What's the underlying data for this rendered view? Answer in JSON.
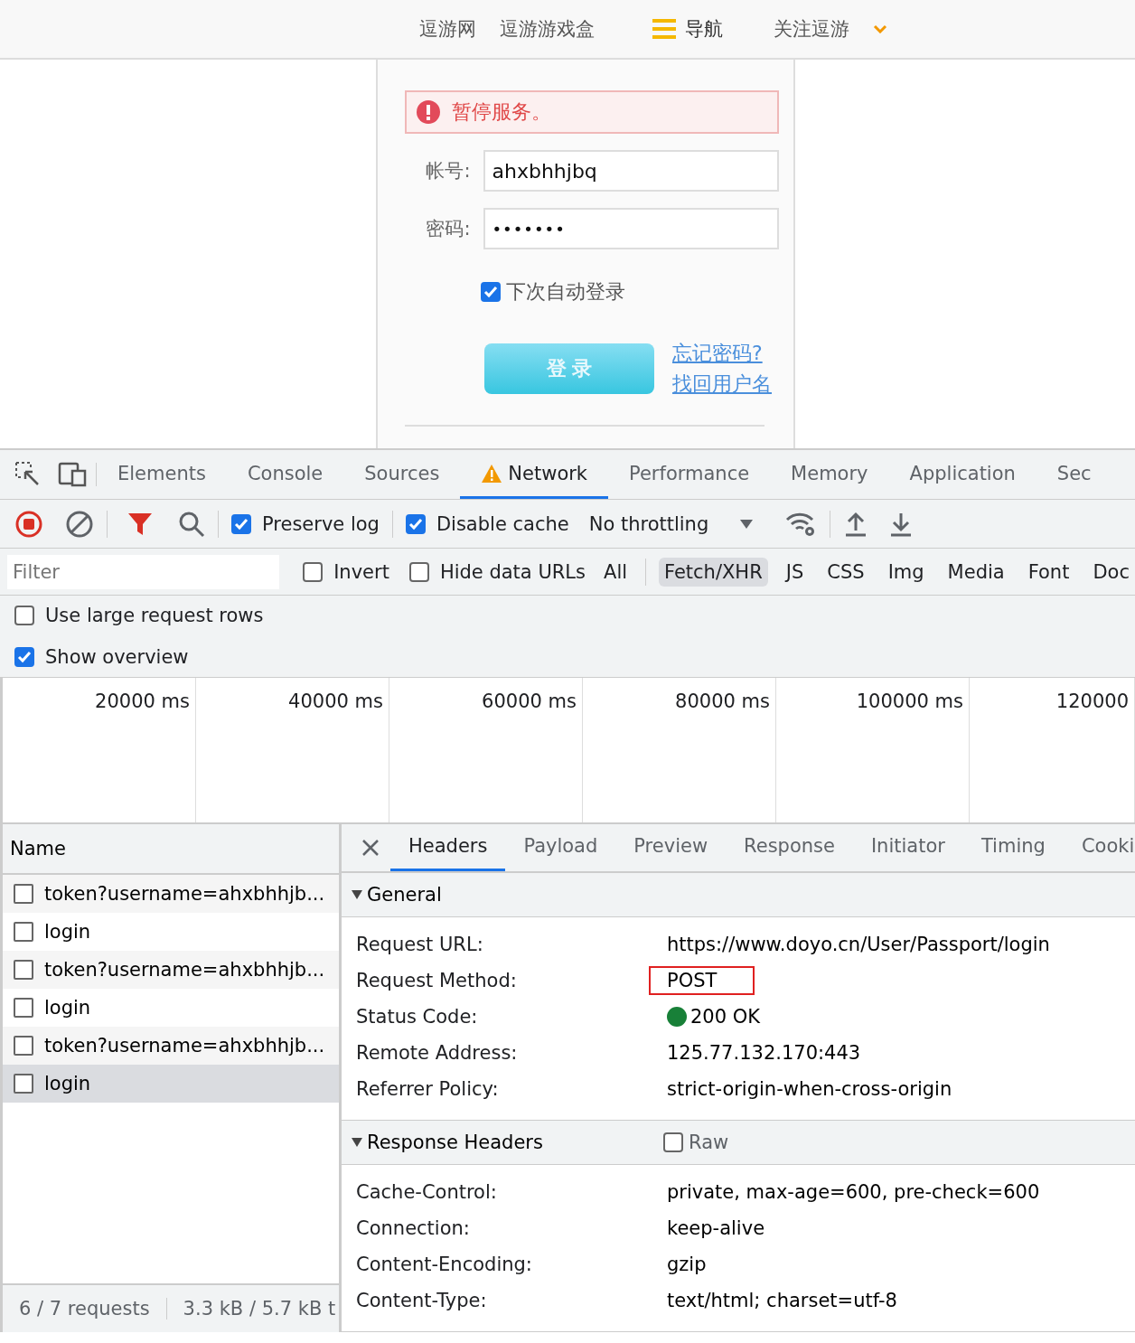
{
  "site_nav": {
    "links": [
      "逗游网",
      "逗游游戏盒"
    ],
    "menu_label": "导航",
    "follow_label": "关注逗游"
  },
  "login_form": {
    "error": "暂停服务。",
    "fields": [
      {
        "label": "帐号:",
        "value": "ahxbhhjbq",
        "kind": "text"
      },
      {
        "label": "密码:",
        "value": "•••••••",
        "kind": "password"
      }
    ],
    "remember": {
      "label": "下次自动登录",
      "checked": true
    },
    "submit": "登 录",
    "links": [
      "忘记密码?",
      "找回用户名"
    ]
  },
  "devtools": {
    "tabs": [
      {
        "label": "Elements",
        "selected": false,
        "warning": false
      },
      {
        "label": "Console",
        "selected": false,
        "warning": false
      },
      {
        "label": "Sources",
        "selected": false,
        "warning": false
      },
      {
        "label": "Network",
        "selected": true,
        "warning": true
      },
      {
        "label": "Performance",
        "selected": false,
        "warning": false
      },
      {
        "label": "Memory",
        "selected": false,
        "warning": false
      },
      {
        "label": "Application",
        "selected": false,
        "warning": false
      },
      {
        "label": "Sec",
        "selected": false,
        "warning": false
      }
    ],
    "toolbar": {
      "preserve_log": {
        "label": "Preserve log",
        "checked": true
      },
      "disable_cache": {
        "label": "Disable cache",
        "checked": true
      },
      "throttling": "No throttling"
    },
    "filter": {
      "placeholder": "Filter",
      "invert": {
        "label": "Invert",
        "checked": false
      },
      "hide_data_urls": {
        "label": "Hide data URLs",
        "checked": false
      },
      "types": [
        {
          "label": "All",
          "selected": false
        },
        {
          "label": "Fetch/XHR",
          "selected": true
        },
        {
          "label": "JS",
          "selected": false
        },
        {
          "label": "CSS",
          "selected": false
        },
        {
          "label": "Img",
          "selected": false
        },
        {
          "label": "Media",
          "selected": false
        },
        {
          "label": "Font",
          "selected": false
        },
        {
          "label": "Doc",
          "selected": false
        }
      ]
    },
    "options": [
      {
        "label": "Use large request rows",
        "checked": false
      },
      {
        "label": "Show overview",
        "checked": true
      }
    ],
    "overview_ticks": [
      "20000 ms",
      "40000 ms",
      "60000 ms",
      "80000 ms",
      "100000 ms",
      "120000"
    ],
    "requests": {
      "column": "Name",
      "rows": [
        {
          "name": "token?username=ahxbhhjb...",
          "selected": false
        },
        {
          "name": "login",
          "selected": false
        },
        {
          "name": "token?username=ahxbhhjb...",
          "selected": false
        },
        {
          "name": "login",
          "selected": false
        },
        {
          "name": "token?username=ahxbhhjb...",
          "selected": false
        },
        {
          "name": "login",
          "selected": true
        }
      ],
      "status": [
        "6 / 7 requests",
        "3.3 kB / 5.7 kB t"
      ]
    },
    "detail": {
      "tabs": [
        {
          "label": "Headers",
          "selected": true
        },
        {
          "label": "Payload",
          "selected": false
        },
        {
          "label": "Preview",
          "selected": false
        },
        {
          "label": "Response",
          "selected": false
        },
        {
          "label": "Initiator",
          "selected": false
        },
        {
          "label": "Timing",
          "selected": false
        },
        {
          "label": "Cooki",
          "selected": false
        }
      ],
      "sections": [
        {
          "title": "General",
          "expanded": true,
          "rows": [
            {
              "key": "Request URL:",
              "value": "https://www.doyo.cn/User/Passport/login",
              "highlighted": false
            },
            {
              "key": "Request Method:",
              "value": "POST",
              "highlighted": true
            },
            {
              "key": "Status Code:",
              "value": "200 OK",
              "highlighted": false,
              "color": "#188038"
            },
            {
              "key": "Remote Address:",
              "value": "125.77.132.170:443",
              "highlighted": false
            },
            {
              "key": "Referrer Policy:",
              "value": "strict-origin-when-cross-origin",
              "highlighted": false
            }
          ]
        },
        {
          "title": "Response Headers",
          "expanded": true,
          "raw": {
            "label": "Raw",
            "checked": false
          },
          "rows": [
            {
              "key": "Cache-Control:",
              "value": "private, max-age=600, pre-check=600",
              "highlighted": false
            },
            {
              "key": "Connection:",
              "value": "keep-alive",
              "highlighted": false
            },
            {
              "key": "Content-Encoding:",
              "value": "gzip",
              "highlighted": false
            },
            {
              "key": "Content-Type:",
              "value": "text/html; charset=utf-8",
              "highlighted": false
            }
          ]
        }
      ]
    }
  }
}
